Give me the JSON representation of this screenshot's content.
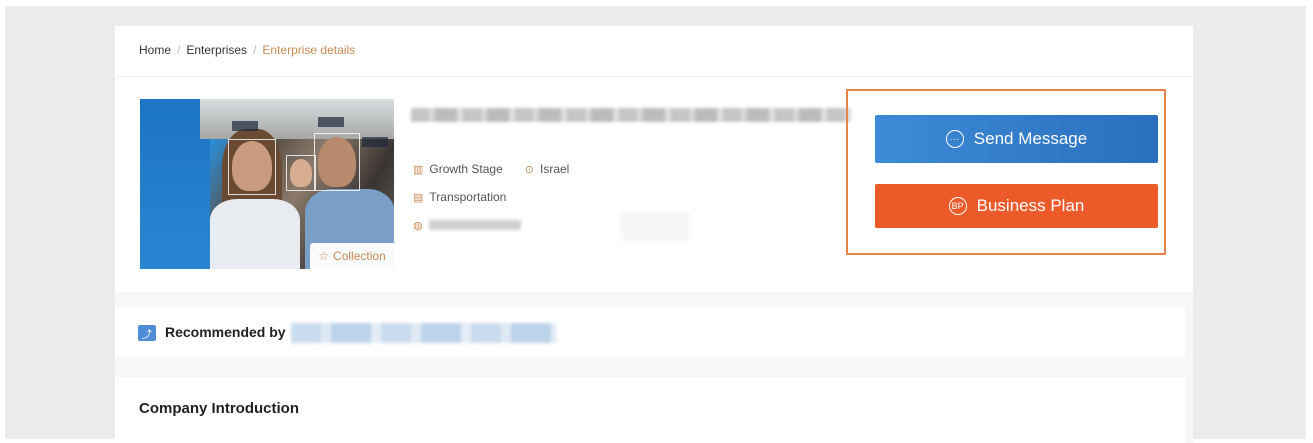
{
  "breadcrumb": {
    "home": "Home",
    "enterprises": "Enterprises",
    "current": "Enterprise details",
    "separator": "/"
  },
  "company": {
    "collection_label": "Collection",
    "stage": "Growth Stage",
    "location": "Israel",
    "industry": "Transportation"
  },
  "actions": {
    "send_message": "Send Message",
    "business_plan": "Business Plan",
    "business_plan_icon_text": "BP"
  },
  "recommend": {
    "label": "Recommended by"
  },
  "intro": {
    "title": "Company Introduction"
  },
  "icons": {
    "stage": "bar-chart-icon",
    "location": "location-pin-icon",
    "industry": "document-icon",
    "website": "globe-icon",
    "collection": "star-icon",
    "message": "chat-bubble-icon",
    "recommend": "chart-badge-icon"
  },
  "colors": {
    "send_button": "#2a6fbe",
    "plan_button": "#ec5a29",
    "highlight": "#e8834a",
    "accent": "#c88a55"
  }
}
